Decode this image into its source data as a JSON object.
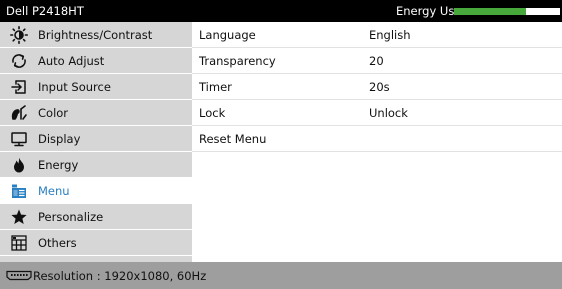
{
  "header": {
    "model": "Dell P2418HT",
    "energy_label": "Energy Use",
    "energy_level": 0.68,
    "energy_color": "#47a83c"
  },
  "sidebar": {
    "items": [
      {
        "label": "Brightness/Contrast",
        "icon": "brightness-icon"
      },
      {
        "label": "Auto Adjust",
        "icon": "auto-adjust-icon"
      },
      {
        "label": "Input Source",
        "icon": "input-source-icon"
      },
      {
        "label": "Color",
        "icon": "color-icon"
      },
      {
        "label": "Display",
        "icon": "display-icon"
      },
      {
        "label": "Energy",
        "icon": "energy-icon"
      },
      {
        "label": "Menu",
        "icon": "menu-icon",
        "selected": true
      },
      {
        "label": "Personalize",
        "icon": "star-icon"
      },
      {
        "label": "Others",
        "icon": "others-icon"
      }
    ],
    "selected_color": "#2a7fc1"
  },
  "panel": {
    "rows": [
      {
        "name": "Language",
        "value": "English"
      },
      {
        "name": "Transparency",
        "value": "20"
      },
      {
        "name": "Timer",
        "value": "20s"
      },
      {
        "name": "Lock",
        "value": "Unlock"
      },
      {
        "name": "Reset Menu",
        "value": ""
      }
    ]
  },
  "status": {
    "resolution": "Resolution : 1920x1080, 60Hz",
    "icon": "connector-icon"
  }
}
